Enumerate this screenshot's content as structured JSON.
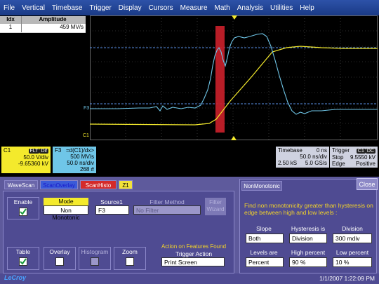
{
  "menu": [
    "File",
    "Vertical",
    "Timebase",
    "Trigger",
    "Display",
    "Cursors",
    "Measure",
    "Math",
    "Analysis",
    "Utilities",
    "Help"
  ],
  "table": {
    "headers": [
      "Idx",
      "Amplitude"
    ],
    "rows": [
      {
        "idx": "1",
        "amplitude": "459 MV/s"
      }
    ]
  },
  "markers": {
    "f3": "F3",
    "c1": "C1"
  },
  "c1": {
    "name": "C1",
    "tag": "FLT",
    "tag2": "Dif",
    "line1": "50.0 V/div",
    "line2": "-9.65360 kV"
  },
  "f3": {
    "name": "F3",
    "line1": "=d(C1)/dx>",
    "line2": "500 MV/s",
    "line3": "50.0 ns/div",
    "line4": "268 #"
  },
  "timebase": {
    "label": "Timebase",
    "val": "0 ns",
    "r2": "50.0 ns/div",
    "r3a": "2.50 kS",
    "r3b": "5.0 GS/s"
  },
  "trigger": {
    "label": "Trigger",
    "tag": "C1",
    "tag2": "DC",
    "r2a": "Stop",
    "r2b": "9.5550 kV",
    "r3a": "Edge",
    "r3b": "Positive"
  },
  "tabs": {
    "wavescan": "WaveScan",
    "scanoverlay": "ScanOverlay",
    "scanhisto": "ScanHisto",
    "z1": "Z1"
  },
  "panel": {
    "enable": "Enable",
    "mode": "Mode",
    "mode_value": "Non Monotonic",
    "source1": "Source1",
    "source1_value": "F3",
    "filter_method": "Filter Method",
    "filter_value": "No Filter",
    "filter_wizard": "Filter\nWizard",
    "table": "Table",
    "overlay": "Overlay",
    "histogram": "Histogram",
    "zoom": "Zoom",
    "action": "Action on Features Found",
    "trigger_action": "Trigger Action",
    "trigger_action_value": "Print Screen"
  },
  "nonmono": {
    "tab": "NonMonotonic",
    "close": "Close",
    "desc": "Find non monotonicity greater than hysteresis on edge between high and low levels :",
    "slope": "Slope",
    "slope_value": "Both",
    "hyst": "Hysteresis is",
    "hyst_value": "Division",
    "division": "Division",
    "division_value": "300 mdiv",
    "levels": "Levels are",
    "levels_value": "Percent",
    "high": "High percent",
    "high_value": "90 %",
    "low": "Low percent",
    "low_value": "10 %"
  },
  "status": {
    "clock": "1/1/2007 1:22:09 PM",
    "logo": "LeCroy"
  },
  "colors": {
    "c1": "#f4ea2c",
    "f3": "#6fc6e8",
    "highlight": "#c8202a",
    "dialog": "#5e5a9c"
  }
}
